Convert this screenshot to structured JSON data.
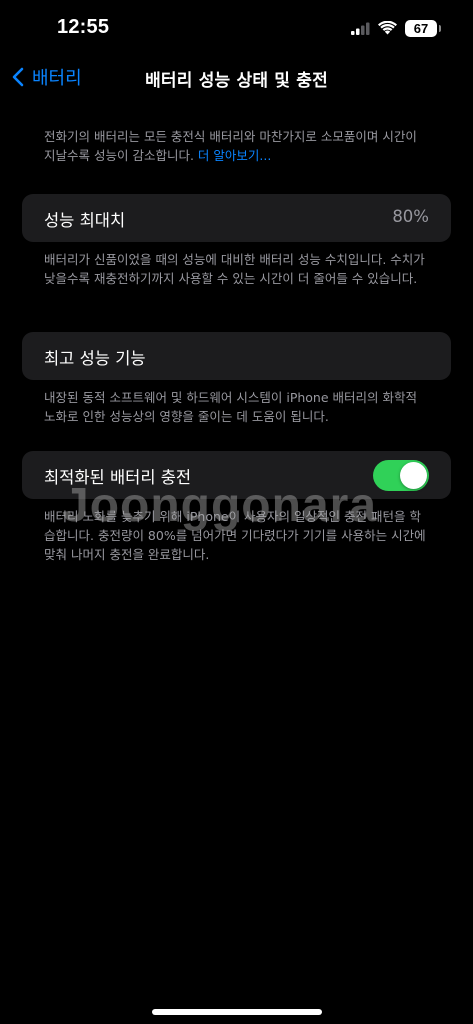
{
  "status_bar": {
    "time": "12:55",
    "battery_level": "67",
    "icons": [
      "cellular-signal-icon",
      "wifi-icon",
      "battery-icon"
    ]
  },
  "nav": {
    "back_label": "배터리",
    "title": "배터리 성능 상태 및 충전"
  },
  "intro": {
    "text": "전화기의 배터리는 모든 충전식 배터리와 마찬가지로 소모품이며 시간이 지날수록 성능이 감소합니다. ",
    "link": "더 알아보기..."
  },
  "maximum_capacity": {
    "label": "성능 최대치",
    "value": "80%",
    "description": "배터리가 신품이었을 때의 성능에 대비한 배터리 성능 수치입니다. 수치가 낮을수록 재충전하기까지 사용할 수 있는 시간이 더 줄어들 수 있습니다."
  },
  "peak_performance": {
    "label": "최고 성능 기능",
    "description": "내장된 동적 소프트웨어 및 하드웨어 시스템이 iPhone 배터리의 화학적 노화로 인한 성능상의 영향을 줄이는 데 도움이 됩니다."
  },
  "optimized_charging": {
    "label": "최적화된 배터리 충전",
    "enabled": true,
    "description": "배터리 노화를 늦추기 위해 iPhone이 사용자의 일상적인 충전 패턴을 학습합니다. 충전량이 80%를 넘어가면 기다렸다가 기기를 사용하는 시간에 맞춰 나머지 충전을 완료합니다."
  },
  "watermark": "Joonggonara",
  "colors": {
    "accent": "#0a84ff",
    "toggle_on": "#30d158",
    "card_bg": "#1c1c1e",
    "secondary_text": "#98989f"
  }
}
